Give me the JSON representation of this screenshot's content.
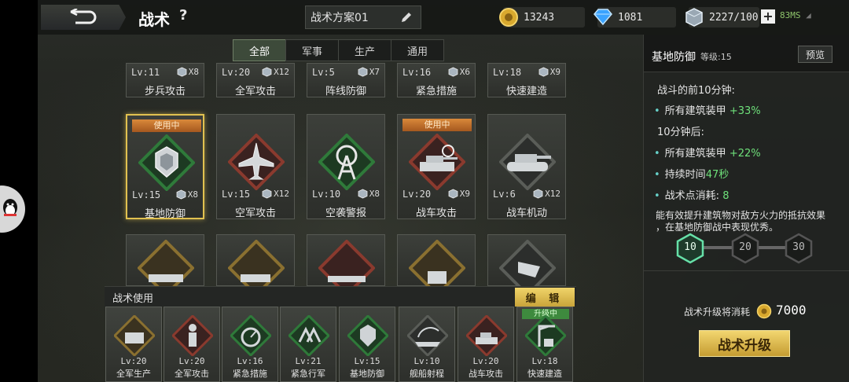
{
  "topbar": {
    "title": "战术",
    "help": "?",
    "scheme_name": "战术方案01",
    "gold": "13243",
    "diamonds": "1081",
    "crystal": "2227/100",
    "plus": "+",
    "ping": "83MS"
  },
  "tabs": [
    {
      "label": "全部",
      "active": true
    },
    {
      "label": "军事",
      "active": false
    },
    {
      "label": "生产",
      "active": false
    },
    {
      "label": "通用",
      "active": false
    }
  ],
  "grid_row1": [
    {
      "lv": "Lv:11",
      "cost": "X8",
      "name": "步兵攻击"
    },
    {
      "lv": "Lv:20",
      "cost": "X12",
      "name": "全军攻击"
    },
    {
      "lv": "Lv:5",
      "cost": "X7",
      "name": "阵线防御"
    },
    {
      "lv": "Lv:16",
      "cost": "X6",
      "name": "紧急措施"
    },
    {
      "lv": "Lv:18",
      "cost": "X9",
      "name": "快速建造"
    }
  ],
  "grid_row2": [
    {
      "lv": "Lv:15",
      "cost": "X8",
      "name": "基地防御",
      "badge": "使用中",
      "selected": true,
      "icon": "shield-fortress-icon",
      "frame": "#2f7a3a"
    },
    {
      "lv": "Lv:15",
      "cost": "X12",
      "name": "空军攻击",
      "badge": "",
      "icon": "jet-fighter-icon",
      "frame": "#8a3a2e"
    },
    {
      "lv": "Lv:10",
      "cost": "X8",
      "name": "空袭警报",
      "badge": "",
      "icon": "radar-tower-icon",
      "frame": "#2f7a3a"
    },
    {
      "lv": "Lv:20",
      "cost": "X9",
      "name": "战车攻击",
      "badge": "使用中",
      "icon": "tank-target-icon",
      "frame": "#8a3a2e"
    },
    {
      "lv": "Lv:6",
      "cost": "X12",
      "name": "战车机动",
      "badge": "",
      "icon": "tank-icon",
      "frame": "#4a4d48"
    }
  ],
  "grid_row3_icons": [
    "factory-gear-icon",
    "artillery-icon",
    "battleship-icon",
    "production-icon",
    "flag-icon"
  ],
  "loadout": {
    "title": "战术使用",
    "edit": "编 辑",
    "slots": [
      {
        "lv": "Lv:20",
        "name": "全军生产",
        "icon": "factory-icon",
        "badge": ""
      },
      {
        "lv": "Lv:20",
        "name": "全军攻击",
        "icon": "soldier-icon",
        "badge": ""
      },
      {
        "lv": "Lv:16",
        "name": "紧急措施",
        "icon": "gauge-icon",
        "badge": ""
      },
      {
        "lv": "Lv:21",
        "name": "紧急行军",
        "icon": "march-icon",
        "badge": ""
      },
      {
        "lv": "Lv:15",
        "name": "基地防御",
        "icon": "shield-fortress-icon",
        "badge": ""
      },
      {
        "lv": "Lv:10",
        "name": "舰船射程",
        "icon": "ship-range-icon",
        "badge": ""
      },
      {
        "lv": "Lv:20",
        "name": "战车攻击",
        "icon": "tank-target-icon",
        "badge": ""
      },
      {
        "lv": "Lv:18",
        "name": "快速建造",
        "icon": "crane-icon",
        "badge": "升级中"
      }
    ]
  },
  "detail": {
    "name": "基地防御",
    "level": "等级:15",
    "preview": "预览",
    "line1": "战斗的前10分钟:",
    "b1_label": "所有建筑装甲",
    "b1_value": "+33%",
    "line2": "10分钟后:",
    "b2_label": "所有建筑装甲",
    "b2_value": "+22%",
    "b3_label": "持续时间",
    "b3_value": "47秒",
    "b4_label": "战术点消耗:",
    "b4_value": "8",
    "desc1": "能有效提升建筑物对敌方火力的抵抗效果",
    "desc2": "，在基地防御战中表现优秀。",
    "tiers": [
      "10",
      "20",
      "30"
    ],
    "upgrade_cost_label": "战术升级将消耗",
    "upgrade_cost": "7000",
    "upgrade_button": "战术升级"
  },
  "colors": {
    "accent_gold": "#e1c150",
    "green_value": "#6ee07a",
    "badge_orange": "#c56f2a"
  }
}
